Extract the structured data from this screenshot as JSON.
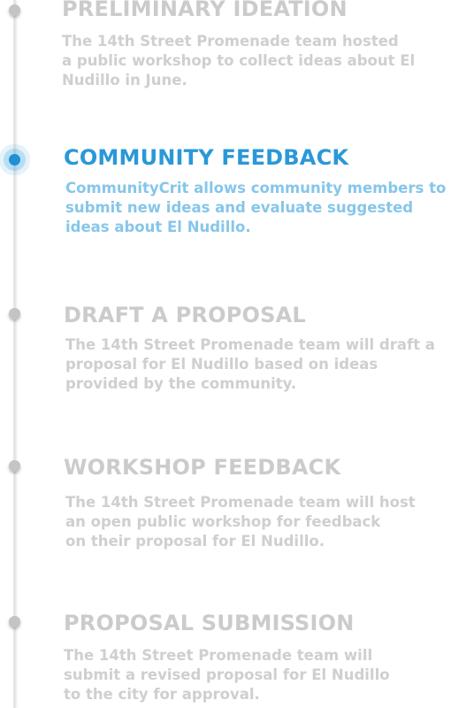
{
  "steps": [
    {
      "title": "PRELIMINARY IDEATION",
      "desc_lines": [
        "The 14th Street Promenade team hosted",
        "a public workshop to collect ideas about El",
        "Nudillo in June."
      ],
      "active": false
    },
    {
      "title": "COMMUNITY FEEDBACK",
      "desc_lines": [
        "CommunityCrit allows community members to",
        "submit new ideas and evaluate suggested",
        "ideas about El Nudillo."
      ],
      "active": true
    },
    {
      "title": "DRAFT A PROPOSAL",
      "desc_lines": [
        "The 14th Street Promenade team will draft a",
        "proposal for El Nudillo based on ideas",
        "provided by the community."
      ],
      "active": false
    },
    {
      "title": "WORKSHOP FEEDBACK",
      "desc_lines": [
        "The 14th Street Promenade team will host",
        "an open public workshop for feedback",
        "on their proposal for El Nudillo."
      ],
      "active": false
    },
    {
      "title": "PROPOSAL SUBMISSION",
      "desc_lines": [
        "The 14th Street Promenade team will",
        "submit a revised proposal for El Nudillo",
        "to the city for approval."
      ],
      "active": false
    }
  ],
  "colors": {
    "active_title": "#2a98d8",
    "active_desc": "#86c6ea",
    "inactive": "#cbcbcb",
    "active_dot": "#1e90d6",
    "inactive_dot": "#c4c4c4"
  }
}
